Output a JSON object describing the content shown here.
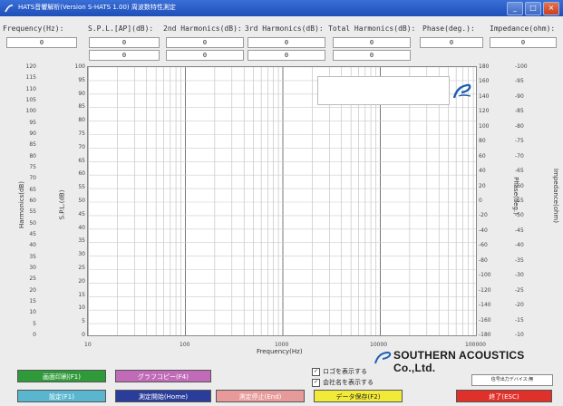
{
  "window": {
    "title": "HATS音響解析(Version S-HATS 1.00) 周波数特性測定",
    "controls": [
      "_",
      "□",
      "×"
    ]
  },
  "headers": {
    "frequency": "Frequency(Hz):",
    "spl": "S.P.L.[AP](dB):",
    "h2": "2nd Harmonics(dB):",
    "h3": "3rd Harmonics(dB):",
    "total": "Total Harmonics(dB):",
    "phase": "Phase(deg.):",
    "impedance": "Impedance(ohm):"
  },
  "values": {
    "frequency": "0",
    "spl_a": "0",
    "spl_b": "0",
    "h2_a": "0",
    "h2_b": "0",
    "h3_a": "0",
    "h3_b": "0",
    "total_a": "0",
    "total_b": "0",
    "phase": "0",
    "impedance": "0"
  },
  "axes": {
    "harmonics_label": "Harmonics(dB)",
    "spl_label": "S.P.L.(dB)",
    "phase_label": "Phase(deg.)",
    "impedance_label": "Impedance(ohm)",
    "x_label": "Frequency(Hz)",
    "harmonics_ticks": [
      "120",
      "115",
      "110",
      "105",
      "100",
      "95",
      "90",
      "85",
      "80",
      "75",
      "70",
      "65",
      "60",
      "55",
      "50",
      "45",
      "40",
      "35",
      "30",
      "25",
      "20",
      "15",
      "10",
      "5",
      "0"
    ],
    "spl_ticks": [
      "100",
      "95",
      "90",
      "85",
      "80",
      "75",
      "70",
      "65",
      "60",
      "55",
      "50",
      "45",
      "40",
      "35",
      "30",
      "25",
      "20",
      "15",
      "10",
      "5",
      "0"
    ],
    "phase_ticks": [
      "180",
      "160",
      "140",
      "120",
      "100",
      "80",
      "60",
      "40",
      "20",
      "0",
      "-20",
      "-40",
      "-60",
      "-80",
      "-100",
      "-120",
      "-140",
      "-160",
      "-180"
    ],
    "impedance_ticks": [
      "-100",
      "-95",
      "-90",
      "-85",
      "-80",
      "-75",
      "-70",
      "-65",
      "-60",
      "-55",
      "-50",
      "-45",
      "-40",
      "-35",
      "-30",
      "-25",
      "-20",
      "-15",
      "-10"
    ],
    "x_ticks": [
      "10",
      "100",
      "1000",
      "10000",
      "100000"
    ]
  },
  "brand": {
    "name": "SOUTHERN ACOUSTICS Co.,Ltd."
  },
  "buttons": {
    "print": "画面印刷(F1)",
    "copy": "グラフコピー(F4)",
    "settings": "設定(F1)",
    "start": "測定開始(Home)",
    "stop": "測定停止(End)",
    "save": "データ保存(F2)",
    "exit": "終了(ESC)"
  },
  "checkboxes": {
    "show_logo": "ロゴを表示する",
    "show_company": "会社名を表示する"
  },
  "device_label": "信号出力デバイス:無",
  "colors": {
    "titlebar": "#2a5cc8",
    "btn_print": "#2f9a3a",
    "btn_copy": "#c06ab8",
    "btn_settings": "#5ab6cf",
    "btn_start": "#2b3d9a",
    "btn_stop": "#e79a9a",
    "btn_save": "#f2ea38",
    "btn_exit": "#e0302a"
  }
}
